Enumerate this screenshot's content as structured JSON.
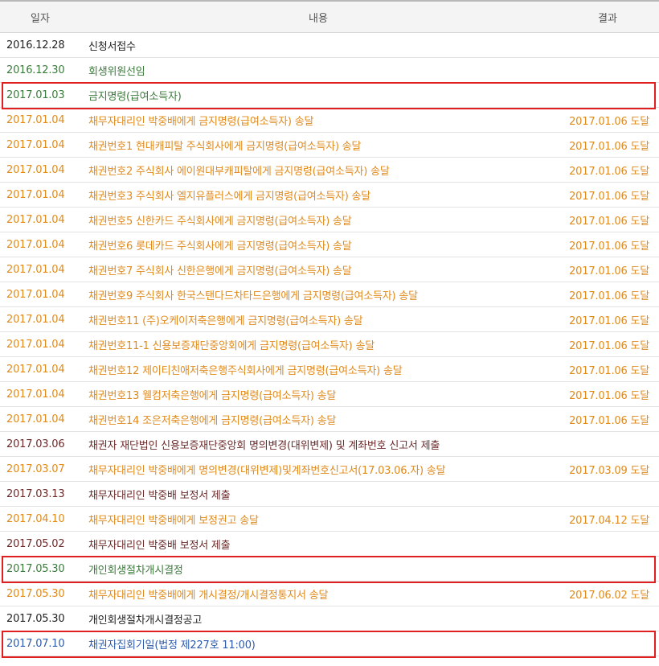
{
  "headers": {
    "date": "일자",
    "content": "내용",
    "result": "결과"
  },
  "rows": [
    {
      "date": "2016.12.28",
      "content": "신청서접수",
      "result": "",
      "tone": "black"
    },
    {
      "date": "2016.12.30",
      "content": "회생위원선임",
      "result": "",
      "tone": "green"
    },
    {
      "date": "2017.01.03",
      "content": "금지명령(급여소득자)",
      "result": "",
      "tone": "green",
      "highlight": true
    },
    {
      "date": "2017.01.04",
      "content": "채무자대리인 박중배에게 금지명령(급여소득자) 송달",
      "result": "2017.01.06 도달",
      "tone": "orange"
    },
    {
      "date": "2017.01.04",
      "content": "채권번호1 현대캐피탈 주식회사에게 금지명령(급여소득자) 송달",
      "result": "2017.01.06 도달",
      "tone": "orange"
    },
    {
      "date": "2017.01.04",
      "content": "채권번호2 주식회사 에이원대부캐피탈에게 금지명령(급여소득자) 송달",
      "result": "2017.01.06 도달",
      "tone": "orange"
    },
    {
      "date": "2017.01.04",
      "content": "채권번호3 주식회사 엘지유플러스에게 금지명령(급여소득자) 송달",
      "result": "2017.01.06 도달",
      "tone": "orange"
    },
    {
      "date": "2017.01.04",
      "content": "채권번호5 신한카드 주식회사에게 금지명령(급여소득자) 송달",
      "result": "2017.01.06 도달",
      "tone": "orange"
    },
    {
      "date": "2017.01.04",
      "content": "채권번호6 롯데카드 주식회사에게 금지명령(급여소득자) 송달",
      "result": "2017.01.06 도달",
      "tone": "orange"
    },
    {
      "date": "2017.01.04",
      "content": "채권번호7 주식회사 신한은행에게 금지명령(급여소득자) 송달",
      "result": "2017.01.06 도달",
      "tone": "orange"
    },
    {
      "date": "2017.01.04",
      "content": "채권번호9 주식회사 한국스탠다드차타드은행에게 금지명령(급여소득자) 송달",
      "result": "2017.01.06 도달",
      "tone": "orange"
    },
    {
      "date": "2017.01.04",
      "content": "채권번호11 (주)오케이저축은행에게 금지명령(급여소득자) 송달",
      "result": "2017.01.06 도달",
      "tone": "orange"
    },
    {
      "date": "2017.01.04",
      "content": "채권번호11-1 신용보증재단중앙회에게 금지명령(급여소득자) 송달",
      "result": "2017.01.06 도달",
      "tone": "orange"
    },
    {
      "date": "2017.01.04",
      "content": "채권번호12 제이티친애저축은행주식회사에게 금지명령(급여소득자) 송달",
      "result": "2017.01.06 도달",
      "tone": "orange"
    },
    {
      "date": "2017.01.04",
      "content": "채권번호13 웰컴저축은행에게 금지명령(급여소득자) 송달",
      "result": "2017.01.06 도달",
      "tone": "orange"
    },
    {
      "date": "2017.01.04",
      "content": "채권번호14 조은저축은행에게 금지명령(급여소득자) 송달",
      "result": "2017.01.06 도달",
      "tone": "orange"
    },
    {
      "date": "2017.03.06",
      "content": "채권자 재단법인 신용보증재단중앙회 명의변경(대위변제) 및 계좌번호 신고서 제출",
      "result": "",
      "tone": "maroon"
    },
    {
      "date": "2017.03.07",
      "content": "채무자대리인 박중배에게 명의변경(대위변제)및계좌번호신고서(17.03.06.자) 송달",
      "result": "2017.03.09 도달",
      "tone": "orange"
    },
    {
      "date": "2017.03.13",
      "content": "채무자대리인 박중배 보정서 제출",
      "result": "",
      "tone": "maroon"
    },
    {
      "date": "2017.04.10",
      "content": "채무자대리인 박중배에게 보정권고 송달",
      "result": "2017.04.12 도달",
      "tone": "orange"
    },
    {
      "date": "2017.05.02",
      "content": "채무자대리인 박중배 보정서 제출",
      "result": "",
      "tone": "maroon"
    },
    {
      "date": "2017.05.30",
      "content": "개인회생절차개시결정",
      "result": "",
      "tone": "green",
      "highlight": true
    },
    {
      "date": "2017.05.30",
      "content": "채무자대리인 박중배에게 개시결정/개시결정통지서 송달",
      "result": "2017.06.02 도달",
      "tone": "orange"
    },
    {
      "date": "2017.05.30",
      "content": "개인회생절차개시결정공고",
      "result": "",
      "tone": "black"
    },
    {
      "date": "2017.07.10",
      "content": "채권자집회기일(법정 제227호 11:00)",
      "result": "",
      "tone": "blue",
      "highlight": true
    }
  ],
  "colors": {
    "highlight_border": "#e02020",
    "orange": "#e08a1c",
    "green": "#3c7a3c",
    "maroon": "#6b2a2a",
    "blue": "#2e5aa8"
  }
}
